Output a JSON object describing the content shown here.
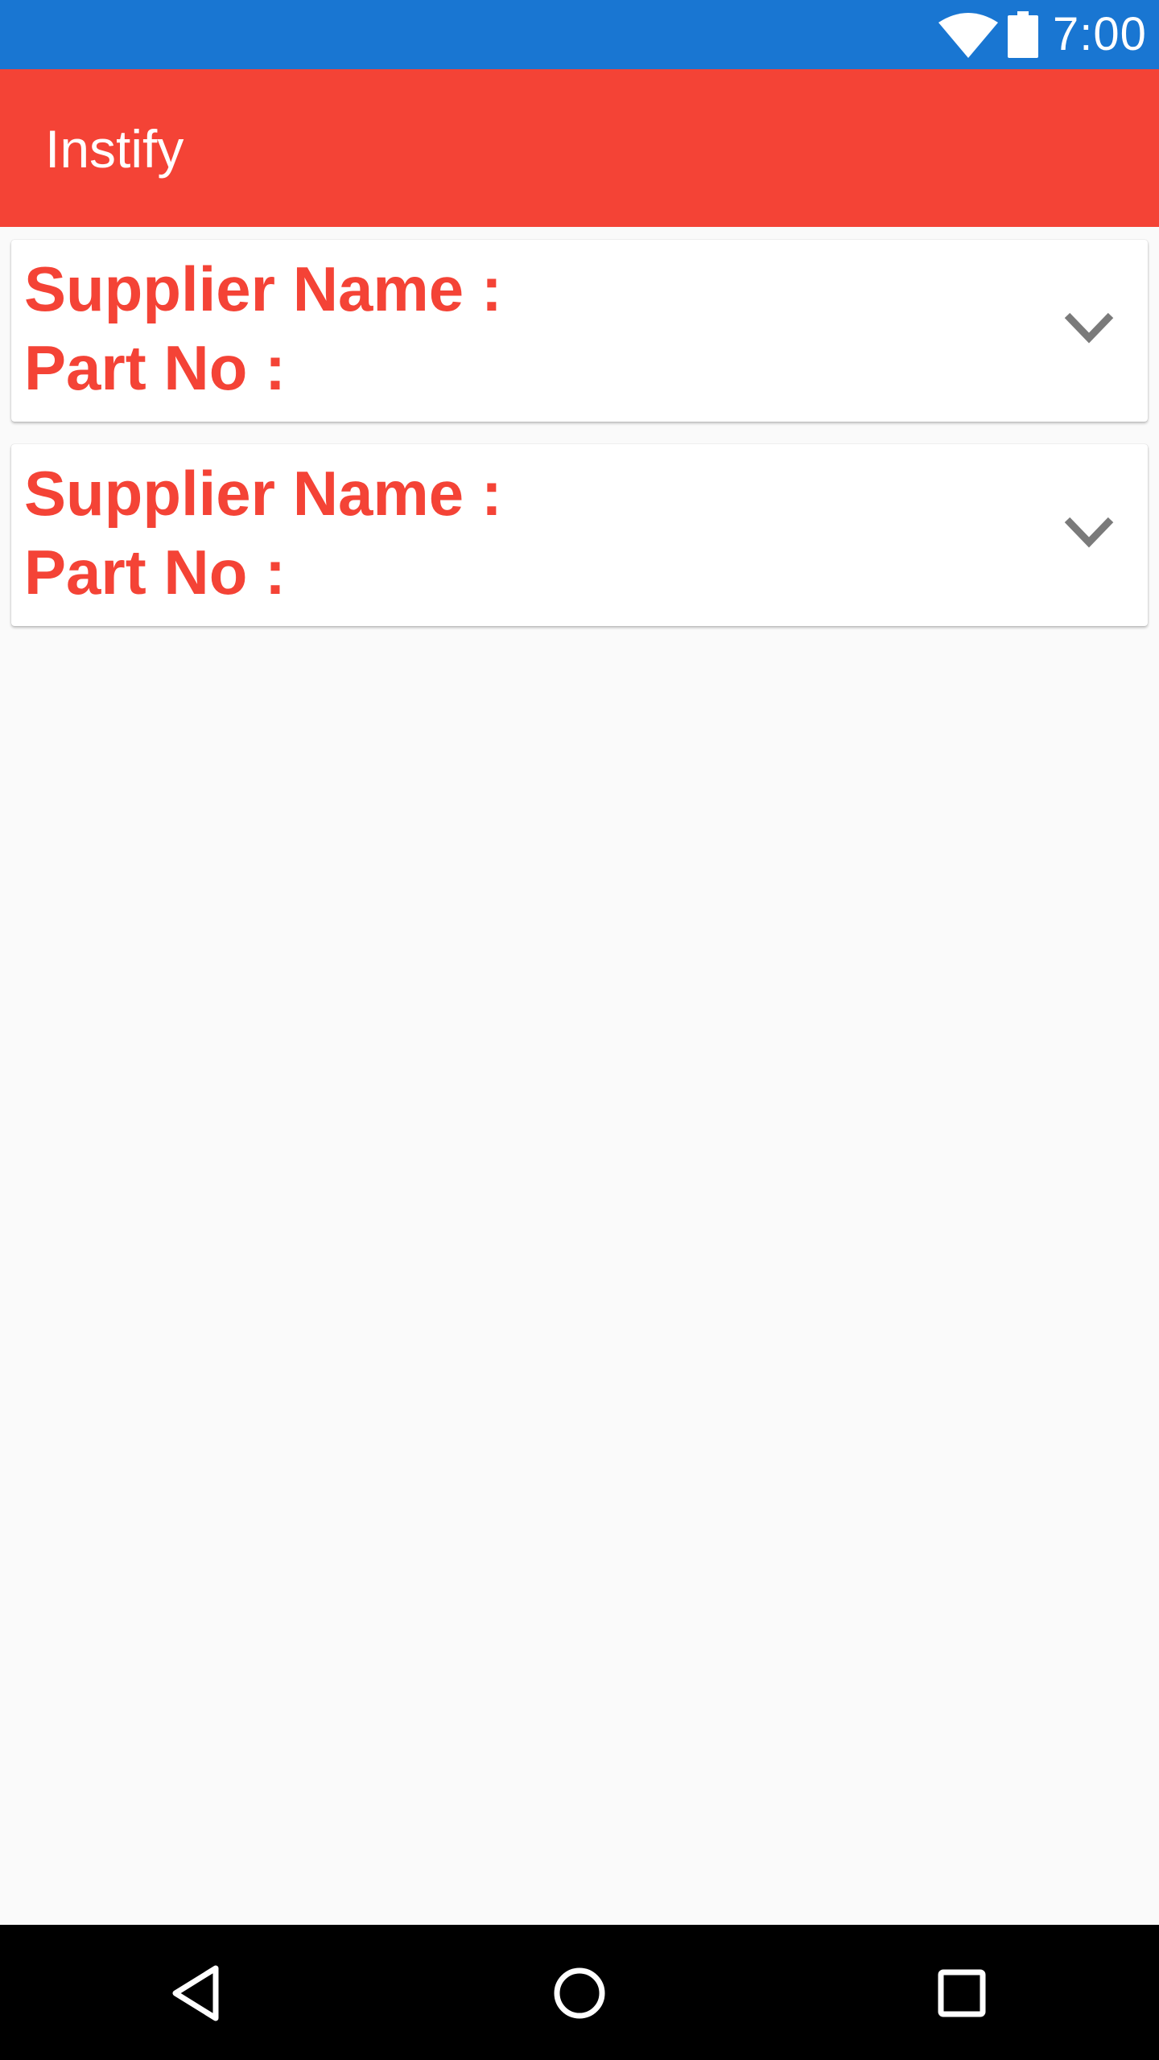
{
  "status_bar": {
    "time": "7:00",
    "icons": [
      "wifi-icon",
      "battery-icon"
    ],
    "color": "#1976d2"
  },
  "app_bar": {
    "title": "Instify",
    "color": "#f44336"
  },
  "cards": [
    {
      "supplier_label": "Supplier Name :",
      "part_label": "Part No :",
      "expand_icon": "chevron-down-icon"
    },
    {
      "supplier_label": "Supplier Name :",
      "part_label": "Part No :",
      "expand_icon": "chevron-down-icon"
    }
  ],
  "nav_bar": {
    "buttons": [
      "back-icon",
      "home-icon",
      "recents-icon"
    ]
  }
}
